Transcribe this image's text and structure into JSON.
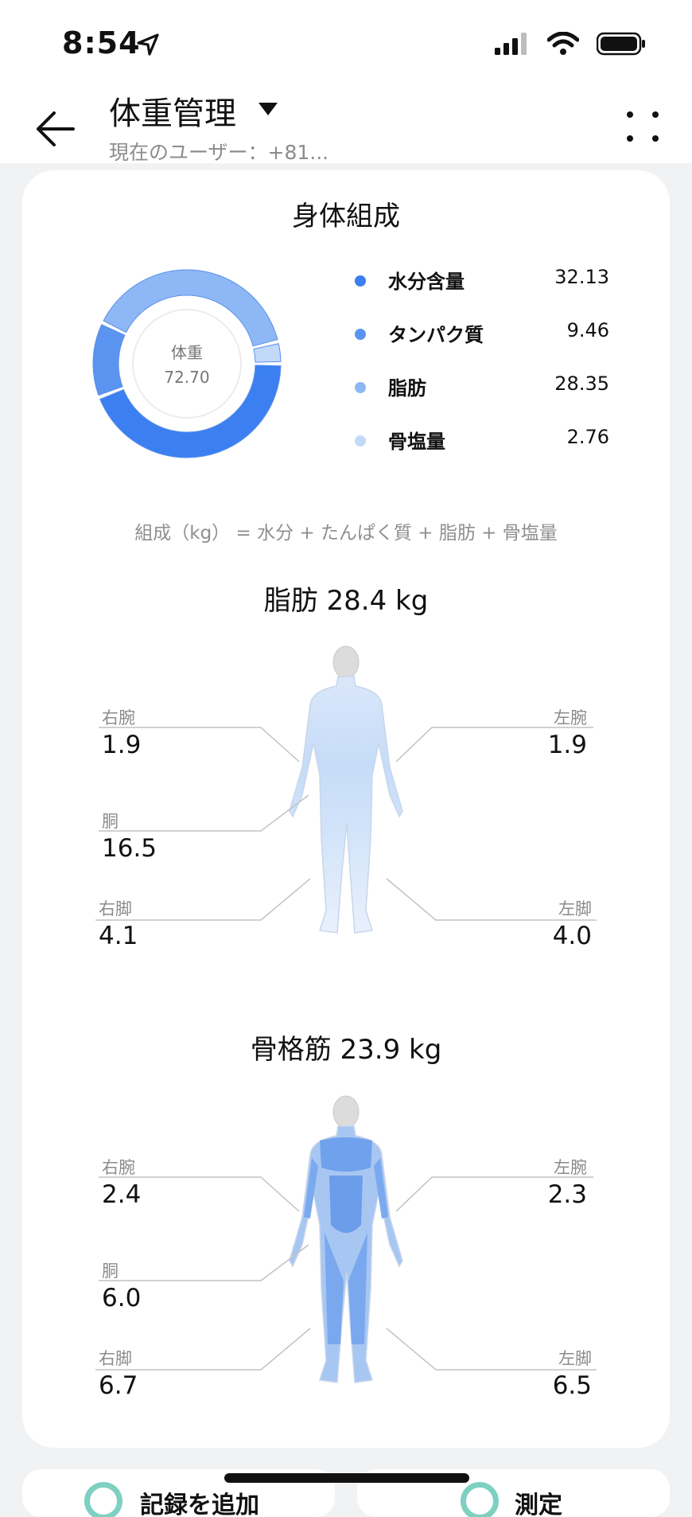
{
  "status": {
    "time": "8:54"
  },
  "header": {
    "title": "体重管理",
    "subtitle": "現在のユーザー：+81..."
  },
  "composition": {
    "title": "身体組成",
    "center_label": "体重",
    "center_value": "72.70",
    "items": [
      {
        "label": "水分含量",
        "value": "32.13",
        "color": "#3b7ff0"
      },
      {
        "label": "タンパク質",
        "value": "9.46",
        "color": "#5a94f0"
      },
      {
        "label": "脂肪",
        "value": "28.35",
        "color": "#8db8f5"
      },
      {
        "label": "骨塩量",
        "value": "2.76",
        "color": "#c3d9f8"
      }
    ],
    "formula": "組成（kg） = 水分 + たんぱく質 + 脂肪 + 骨塩量"
  },
  "fat": {
    "title": "脂肪 28.4 kg",
    "right_arm": {
      "label": "右腕",
      "value": "1.9"
    },
    "left_arm": {
      "label": "左腕",
      "value": "1.9"
    },
    "trunk": {
      "label": "胴",
      "value": "16.5"
    },
    "right_leg": {
      "label": "右脚",
      "value": "4.1"
    },
    "left_leg": {
      "label": "左脚",
      "value": "4.0"
    }
  },
  "muscle": {
    "title": "骨格筋 23.9 kg",
    "right_arm": {
      "label": "右腕",
      "value": "2.4"
    },
    "left_arm": {
      "label": "左腕",
      "value": "2.3"
    },
    "trunk": {
      "label": "胴",
      "value": "6.0"
    },
    "right_leg": {
      "label": "右脚",
      "value": "6.7"
    },
    "left_leg": {
      "label": "左脚",
      "value": "6.5"
    }
  },
  "bottom": {
    "add_record": "記録を追加",
    "measure": "測定"
  },
  "colors": {
    "accent": "#3b7ff0",
    "teal": "#7ed0c1",
    "muted": "#8b8b8b"
  }
}
